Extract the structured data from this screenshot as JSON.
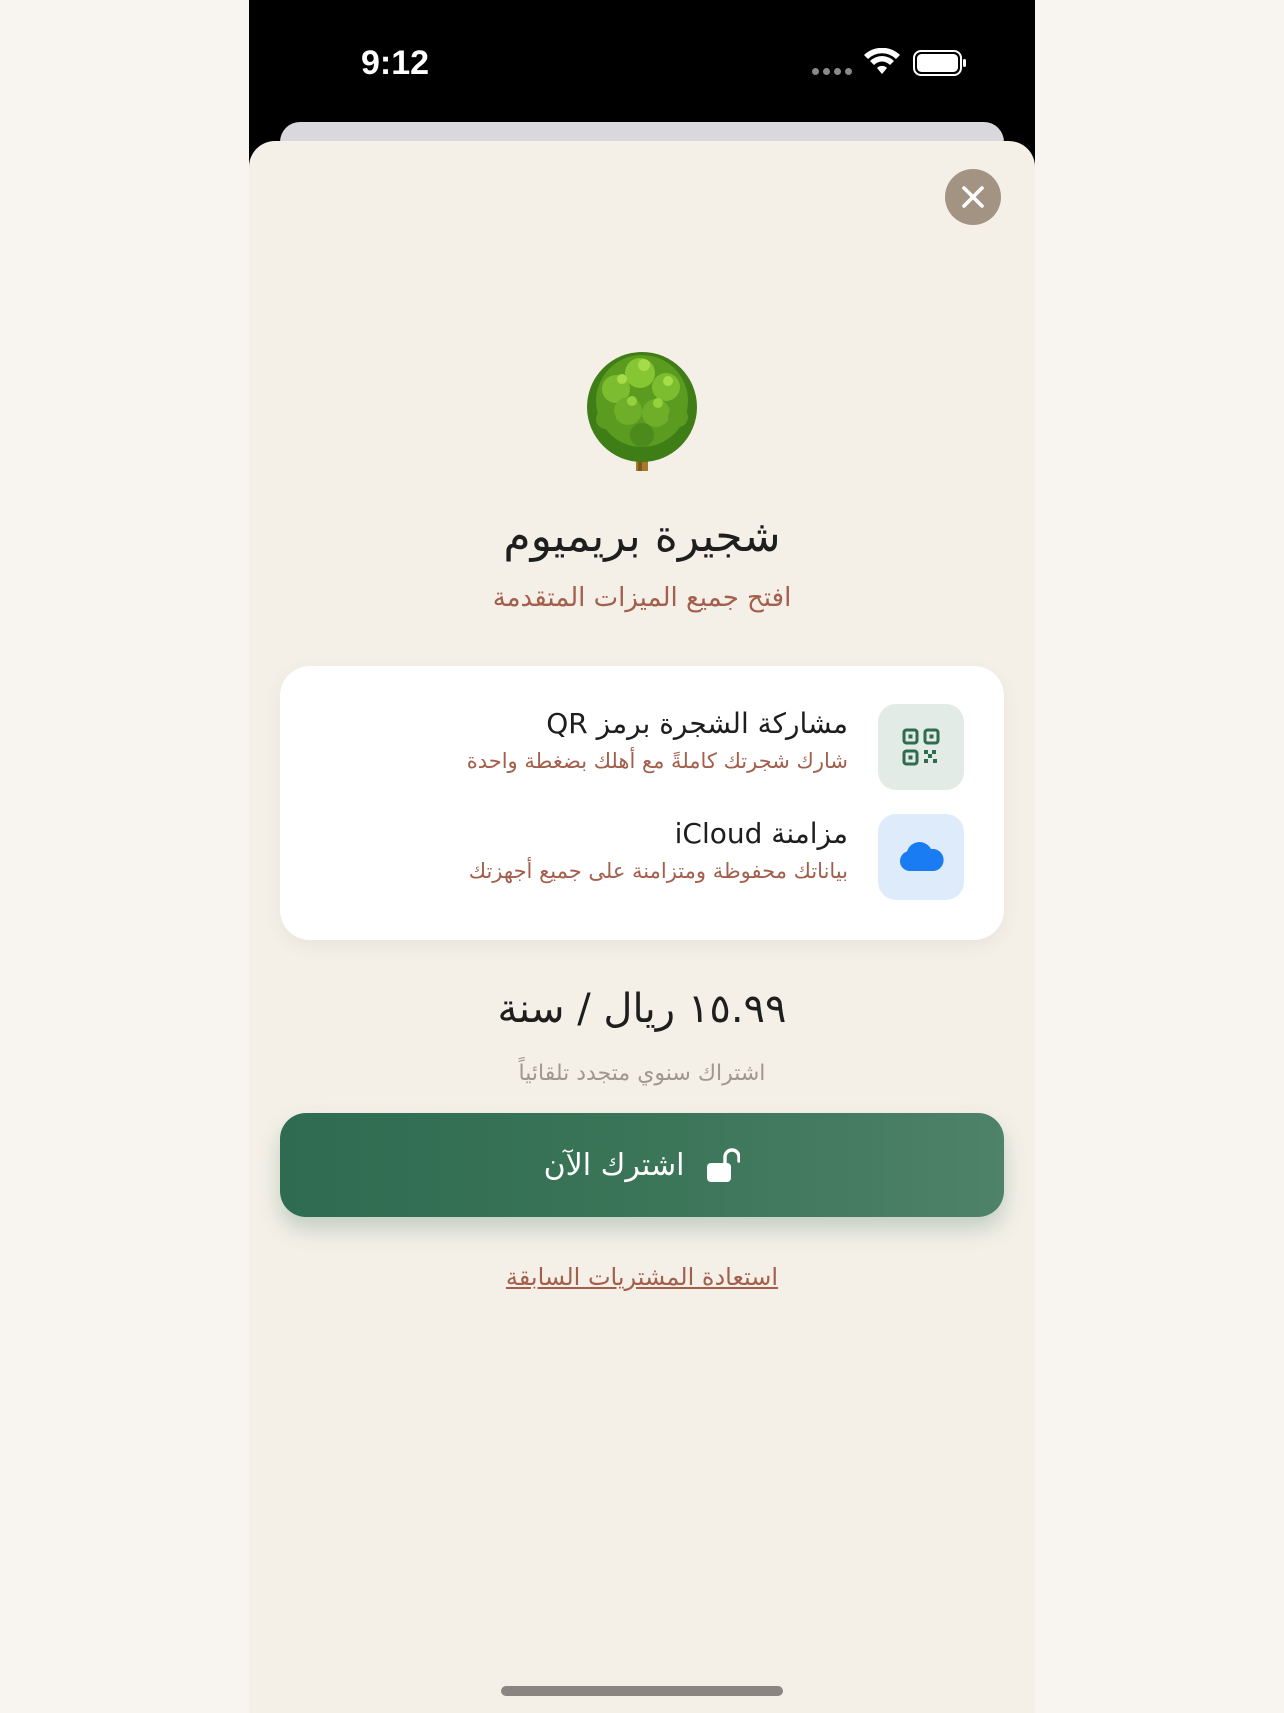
{
  "status_bar": {
    "time": "9:12"
  },
  "paywall": {
    "title": "شجيرة بريميوم",
    "subtitle": "افتح جميع الميزات المتقدمة",
    "features": [
      {
        "icon": "qr-code-icon",
        "title": "مشاركة الشجرة برمز QR",
        "description": "شارك شجرتك كاملةً مع أهلك بضغطة واحدة",
        "icon_bg": "#e2ebe6",
        "icon_color": "#2e6b50"
      },
      {
        "icon": "cloud-icon",
        "title": "مزامنة iCloud",
        "description": "بياناتك محفوظة ومتزامنة على جميع أجهزتك",
        "icon_bg": "#deebfb",
        "icon_color": "#1a7cf2"
      }
    ],
    "price": "١٥.٩٩ ريال / سنة",
    "renewal_note": "اشتراك سنوي متجدد تلقائياً",
    "subscribe_label": "اشترك الآن",
    "restore_label": "استعادة المشتريات السابقة"
  },
  "colors": {
    "accent_green": "#2e6b50",
    "accent_brown": "#a35e4c",
    "sheet_bg": "#f4f0e8"
  }
}
